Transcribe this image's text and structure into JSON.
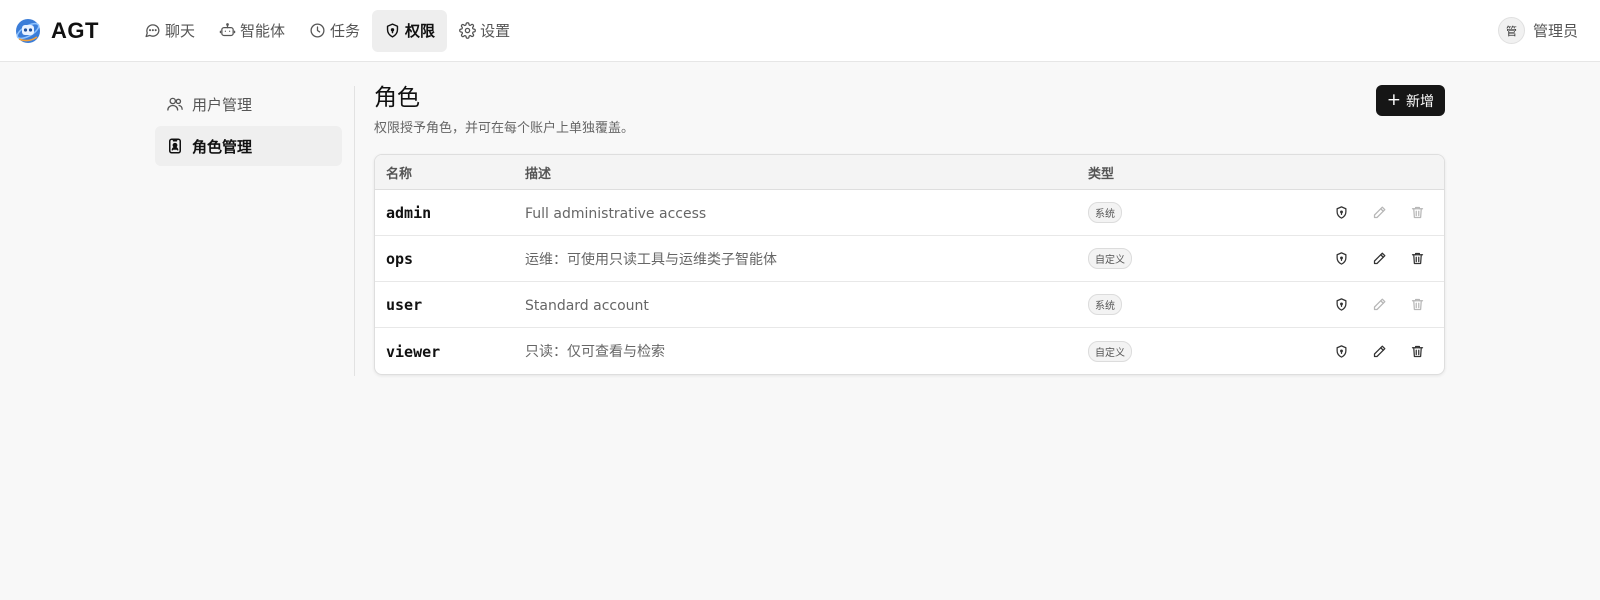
{
  "app": {
    "name": "AGT",
    "logo_icon": "robot-globe-logo"
  },
  "nav": [
    {
      "label": "聊天",
      "icon": "chat-bubble-icon",
      "active": false
    },
    {
      "label": "智能体",
      "icon": "robot-icon",
      "active": false
    },
    {
      "label": "任务",
      "icon": "clock-icon",
      "active": false
    },
    {
      "label": "权限",
      "icon": "shield-icon",
      "active": true
    },
    {
      "label": "设置",
      "icon": "gear-icon",
      "active": false
    }
  ],
  "user": {
    "avatar_initial": "管",
    "name": "管理员"
  },
  "sidebar": {
    "items": [
      {
        "label": "用户管理",
        "icon": "users-icon",
        "active": false
      },
      {
        "label": "角色管理",
        "icon": "id-badge-icon",
        "active": true
      }
    ]
  },
  "page": {
    "title": "角色",
    "subtitle": "权限授予角色，并可在每个账户上单独覆盖。",
    "add_label": "新增"
  },
  "table": {
    "headers": {
      "name": "名称",
      "description": "描述",
      "type": "类型"
    },
    "rows": [
      {
        "name": "admin",
        "description": "Full administrative access",
        "type": "系统",
        "editable": false
      },
      {
        "name": "ops",
        "description": "运维：可使用只读工具与运维类子智能体",
        "type": "自定义",
        "editable": true
      },
      {
        "name": "user",
        "description": "Standard account",
        "type": "系统",
        "editable": false
      },
      {
        "name": "viewer",
        "description": "只读：仅可查看与检索",
        "type": "自定义",
        "editable": true
      }
    ]
  },
  "colors": {
    "accent": "#161616",
    "topbar_bg": "#ffffff",
    "page_bg": "#f8f8f8",
    "active_bg": "#eeeeee"
  }
}
